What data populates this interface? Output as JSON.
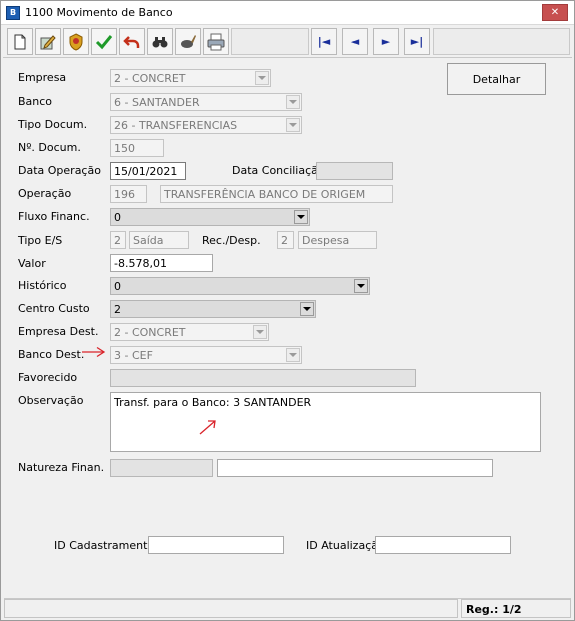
{
  "window": {
    "title": "1100 Movimento de Banco",
    "close_glyph": "✕"
  },
  "toolbar": {
    "icons": [
      "new-document-icon",
      "edit-icon",
      "badge-icon",
      "confirm-check-icon",
      "undo-icon",
      "search-binoculars-icon",
      "eraser-icon",
      "print-icon"
    ],
    "nav": [
      "|◄",
      "◄",
      "►",
      "►|"
    ]
  },
  "form": {
    "empresa": {
      "label": "Empresa",
      "value": "2 - CONCRET"
    },
    "banco": {
      "label": "Banco",
      "value": "6 - SANTANDER"
    },
    "tipo_docum": {
      "label": "Tipo Docum.",
      "value": "26 - TRANSFERENCIAS"
    },
    "n_docum": {
      "label": "Nº. Docum.",
      "value": "150"
    },
    "data_operacao": {
      "label": "Data Operação",
      "value": "15/01/2021"
    },
    "data_conciliacao": {
      "label": "Data Conciliação",
      "value": ""
    },
    "operacao": {
      "label": "Operação",
      "code": "196",
      "desc": "TRANSFERÊNCIA BANCO DE ORIGEM"
    },
    "fluxo_financ": {
      "label": "Fluxo Financ.",
      "value": "0"
    },
    "tipo_es": {
      "label": "Tipo E/S",
      "code": "2",
      "desc": "Saída"
    },
    "rec_desp": {
      "label": "Rec./Desp.",
      "code": "2",
      "desc": "Despesa"
    },
    "valor": {
      "label": "Valor",
      "value": "-8.578,01"
    },
    "historico": {
      "label": "Histórico",
      "value": "0"
    },
    "centro_custo": {
      "label": "Centro Custo",
      "value": "2"
    },
    "empresa_dest": {
      "label": "Empresa Dest.",
      "value": "2 - CONCRET"
    },
    "banco_dest": {
      "label": "Banco Dest.",
      "value": "3 - CEF"
    },
    "favorecido": {
      "label": "Favorecido",
      "value": ""
    },
    "observacao": {
      "label": "Observação",
      "value": "Transf. para o Banco: 3 SANTANDER"
    },
    "natureza_finan": {
      "label": "Natureza Finan.",
      "code": "",
      "desc": ""
    },
    "id_cadastramento": {
      "label": "ID Cadastramento",
      "value": ""
    },
    "id_atualizacao": {
      "label": "ID Atualização",
      "value": ""
    }
  },
  "buttons": {
    "detalhar": "Detalhar"
  },
  "status": {
    "left": "",
    "reg": "Reg.: 1/2"
  },
  "annotations": {
    "arrow_color": "#d9232a"
  }
}
